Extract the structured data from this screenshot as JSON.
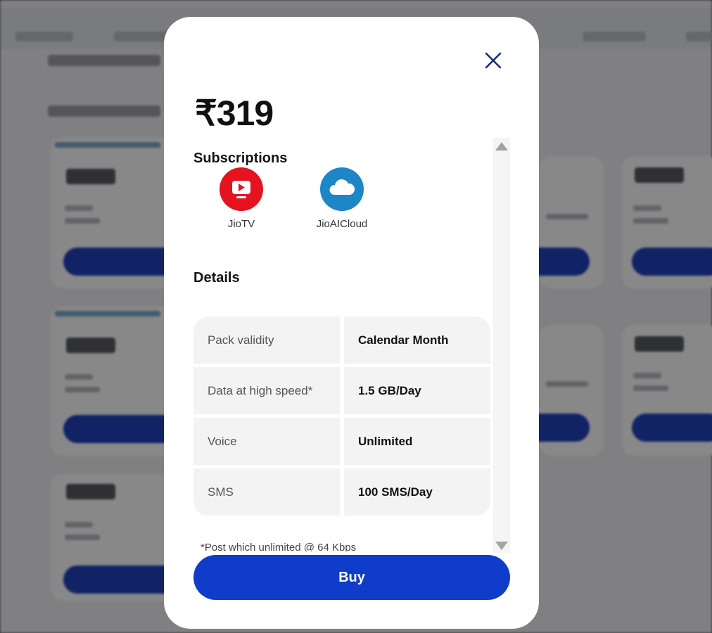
{
  "plan": {
    "price": "₹319"
  },
  "subscriptions": {
    "title": "Subscriptions",
    "items": [
      {
        "label": "JioTV",
        "icon": "jiotv-icon",
        "color": "#e4131f"
      },
      {
        "label": "JioAICloud",
        "icon": "jioaicloud-icon",
        "color": "#1d86c6"
      }
    ]
  },
  "details": {
    "title": "Details",
    "rows": [
      {
        "key": "Pack validity",
        "value": "Calendar Month"
      },
      {
        "key": "Data at high speed*",
        "value": "1.5 GB/Day"
      },
      {
        "key": "Voice",
        "value": "Unlimited"
      },
      {
        "key": "SMS",
        "value": "100 SMS/Day"
      }
    ],
    "footnote": "*Post which unlimited @ 64 Kbps"
  },
  "actions": {
    "buy_label": "Buy"
  },
  "colors": {
    "primary": "#0f3cc9",
    "close_icon": "#1b2e6f"
  }
}
